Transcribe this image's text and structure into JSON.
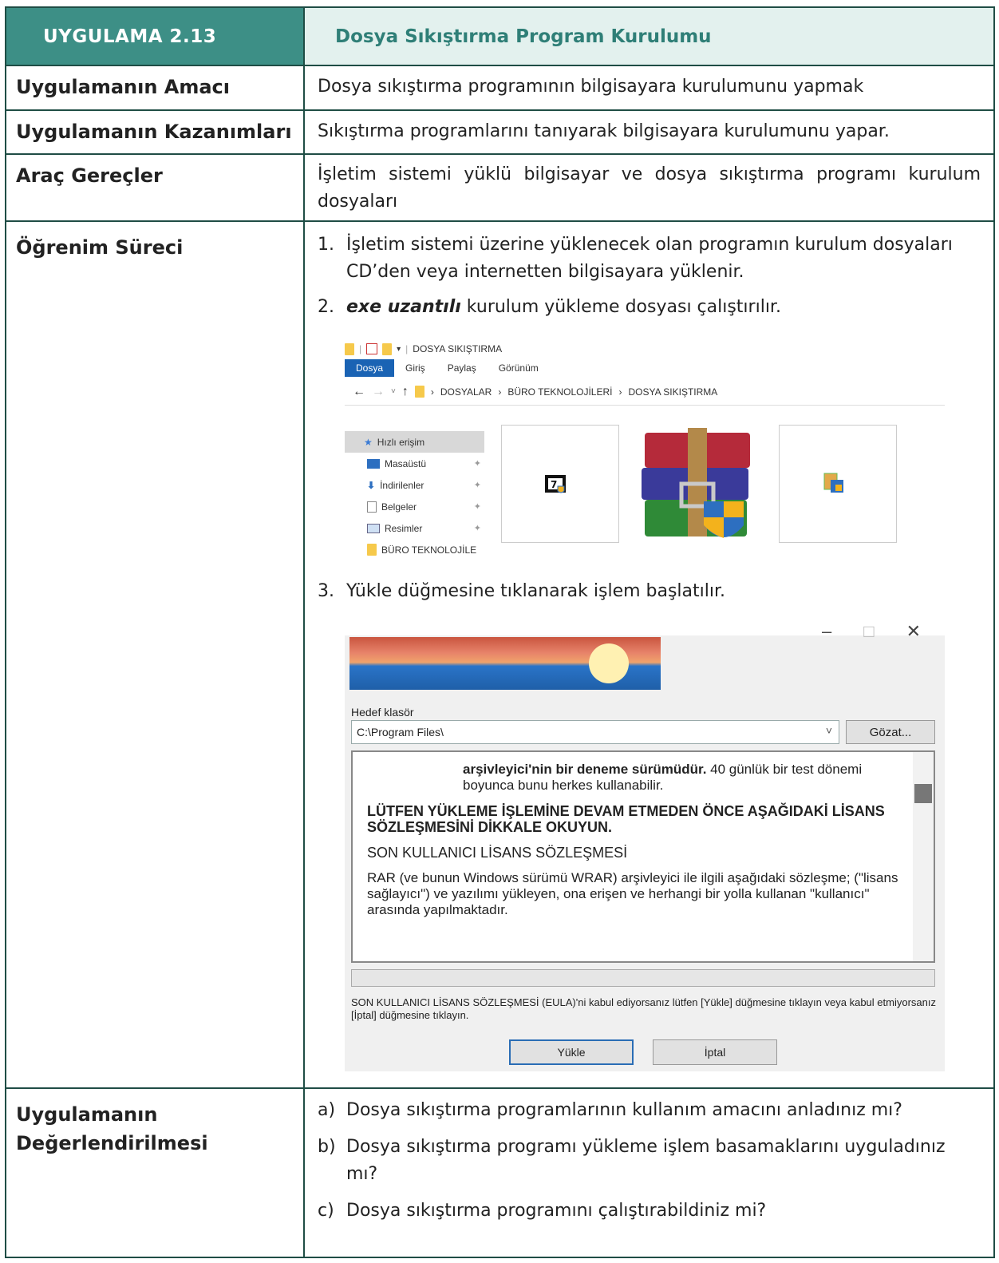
{
  "header": {
    "code": "UYGULAMA 2.13",
    "title": "Dosya Sıkıştırma Program Kurulumu"
  },
  "rows": {
    "amac": {
      "label": "Uygulamanın Amacı",
      "text": "Dosya sıkıştırma programının bilgisayara kurulumunu yapmak"
    },
    "kazanim": {
      "label": "Uygulamanın Kazanımları",
      "text": "Sıkıştırma programlarını tanıyarak bilgisayara kurulumunu yapar."
    },
    "arac": {
      "label": "Araç Gereçler",
      "text": "İşletim sistemi yüklü bilgisayar ve dosya sıkıştırma programı kurulum dosyaları"
    },
    "surec": {
      "label": "Öğrenim Süreci",
      "step1_num": "1.",
      "step1": "İşletim sistemi üzerine yüklenecek olan programın kurulum dosyaları CD’den veya internetten bilgisayara yüklenir.",
      "step2_num": "2.",
      "step2_em": "exe uzantılı",
      "step2": " kurulum yükleme dosyası çalıştırılır.",
      "step3_num": "3.",
      "step3": "Yükle düğmesine tıklanarak işlem başlatılır."
    },
    "degerlendirme": {
      "label_line1": "Uygulamanın",
      "label_line2": "Değerlendirilmesi",
      "a_num": "a)",
      "a": "Dosya sıkıştırma programlarının kullanım amacını anladınız mı?",
      "b_num": "b)",
      "b": "Dosya sıkıştırma programı yükleme işlem basamaklarını uyguladınız mı?",
      "c_num": "c)",
      "c": "Dosya sıkıştırma programını çalıştırabildiniz mi?"
    }
  },
  "explorer": {
    "window_title": "DOSYA SIKIŞTIRMA",
    "tabs": [
      "Dosya",
      "Giriş",
      "Paylaş",
      "Görünüm"
    ],
    "breadcrumb": [
      "DOSYALAR",
      "BÜRO TEKNOLOJİLERİ",
      "DOSYA SIKIŞTIRMA"
    ],
    "nav": [
      "Hızlı erişim",
      "Masaüstü",
      "İndirilenler",
      "Belgeler",
      "Resimler",
      "BÜRO TEKNOLOJİLE"
    ]
  },
  "installer": {
    "folder_label": "Hedef klasör",
    "folder_value": "C:\\Program Files\\",
    "browse": "Gözat...",
    "license_p1_bold": "arşivleyici'nin bir deneme sürümüdür.",
    "license_p1": " 40 günlük bir test dönemi boyunca bunu herkes kullanabilir.",
    "license_p2": "LÜTFEN YÜKLEME İŞLEMİNE DEVAM ETMEDEN ÖNCE AŞAĞIDAKİ LİSANS SÖZLEŞMESİNİ DİKKALE OKUYUN.",
    "license_p3": "SON KULLANICI LİSANS SÖZLEŞMESİ",
    "license_p4": "RAR (ve bunun Windows sürümü WRAR) arşivleyici ile ilgili aşağıdaki sözleşme;                          (\"lisans sağlayıcı\") ve yazılımı yükleyen, ona erişen ve herhangi bir yolla kullanan \"kullanıcı\" arasında yapılmaktadır.",
    "note": "SON KULLANICI LİSANS SÖZLEŞMESİ (EULA)'ni kabul ediyorsanız lütfen [Yükle] düğmesine tıklayın veya kabul etmiyorsanız [İptal] düğmesine tıklayın.",
    "install": "Yükle",
    "cancel": "İptal"
  },
  "colors": {
    "header_bg": "#3d8f86",
    "header_title_bg": "#e3f1ee",
    "border": "#1f4d45"
  }
}
